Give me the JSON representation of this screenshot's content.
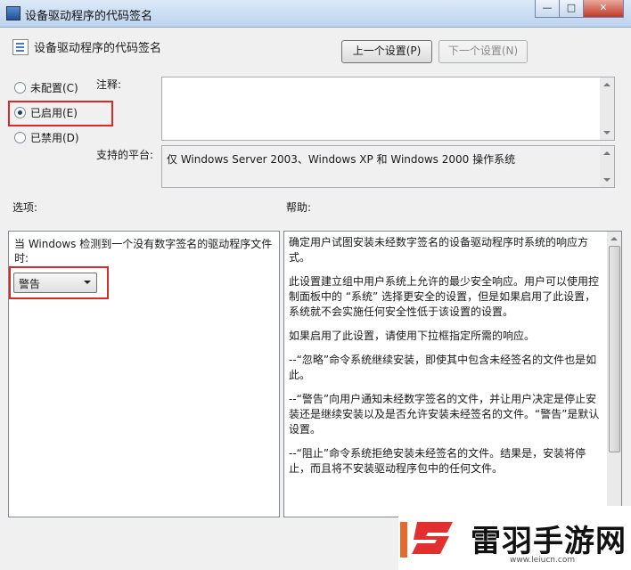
{
  "window": {
    "title": "设备驱动程序的代码签名",
    "minimize_glyph": "—",
    "maximize_glyph": "□",
    "close_glyph": "✕"
  },
  "policy": {
    "name": "设备驱动程序的代码签名"
  },
  "nav": {
    "prev_label": "上一个设置(P)",
    "next_label": "下一个设置(N)"
  },
  "state": {
    "options": [
      {
        "label": "未配置(C)",
        "checked": false
      },
      {
        "label": "已启用(E)",
        "checked": true
      },
      {
        "label": "已禁用(D)",
        "checked": false
      }
    ]
  },
  "comment": {
    "label": "注释:",
    "value": ""
  },
  "platform": {
    "label": "支持的平台:",
    "value": "仅 Windows Server 2003、Windows XP 和 Windows 2000 操作系统"
  },
  "options_panel": {
    "label": "选项:",
    "description": "当 Windows 检测到一个没有数字签名的驱动程序文件时:",
    "select_value": "警告"
  },
  "help_panel": {
    "label": "帮助:",
    "paragraphs": [
      "确定用户试图安装未经数字签名的设备驱动程序时系统的响应方式。",
      "此设置建立组中用户系统上允许的最少安全响应。用户可以使用控制面板中的 “系统” 选择更安全的设置，但是如果启用了此设置，系统就不会实施任何安全性低于该设置的设置。",
      "如果启用了此设置，请使用下拉框指定所需的响应。",
      "--“忽略”命令系统继续安装，即使其中包含未经签名的文件也是如此。",
      "--“警告”向用户通知未经数字签名的文件，并让用户决定是停止安装还是继续安装以及是否允许安装未经签名的文件。“警告”是默认设置。",
      "--“阻止”命令系统拒绝安装未经签名的文件。结果是，安装将停止，而且将不安装驱动程序包中的任何文件。"
    ]
  },
  "watermark": {
    "name": "雷羽手游网",
    "url": "www.leiucn.com"
  },
  "colors": {
    "highlight_border": "#d92a2a",
    "watermark_accent": "#e66a2c"
  }
}
